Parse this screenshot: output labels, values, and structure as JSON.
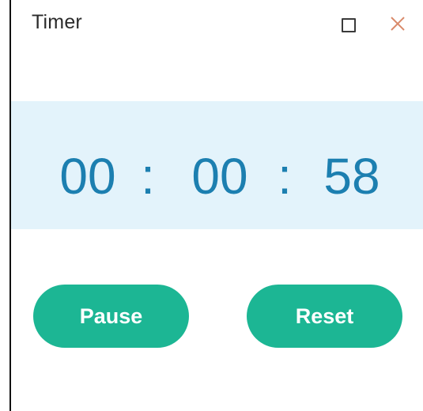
{
  "window": {
    "title": "Timer",
    "maximize_icon": "maximize-icon",
    "close_icon": "close-icon",
    "close_color": "#d98a6a"
  },
  "timer": {
    "hours": "00",
    "minutes": "00",
    "seconds": "58",
    "separator": ":",
    "band_color": "#e3f3fb",
    "digit_color": "#1c7fb0"
  },
  "buttons": {
    "pause_label": "Pause",
    "reset_label": "Reset",
    "color": "#1cb694"
  }
}
